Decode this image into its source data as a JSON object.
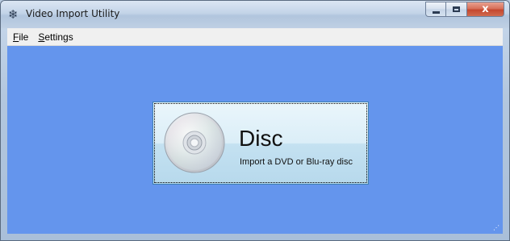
{
  "window": {
    "title": "Video Import Utility",
    "app_icon": "snowflake-icon",
    "controls": {
      "minimize": "minimize-icon",
      "maximize": "maximize-icon",
      "close_label": "x"
    }
  },
  "menu": [
    {
      "accel": "F",
      "rest": "ile"
    },
    {
      "accel": "S",
      "rest": "ettings"
    }
  ],
  "disc_button": {
    "title": "Disc",
    "subtitle": "Import a DVD or Blu-ray disc",
    "icon": "disc-icon"
  },
  "colors": {
    "content_background": "#6495ed",
    "button_border": "#3c7fb1"
  }
}
